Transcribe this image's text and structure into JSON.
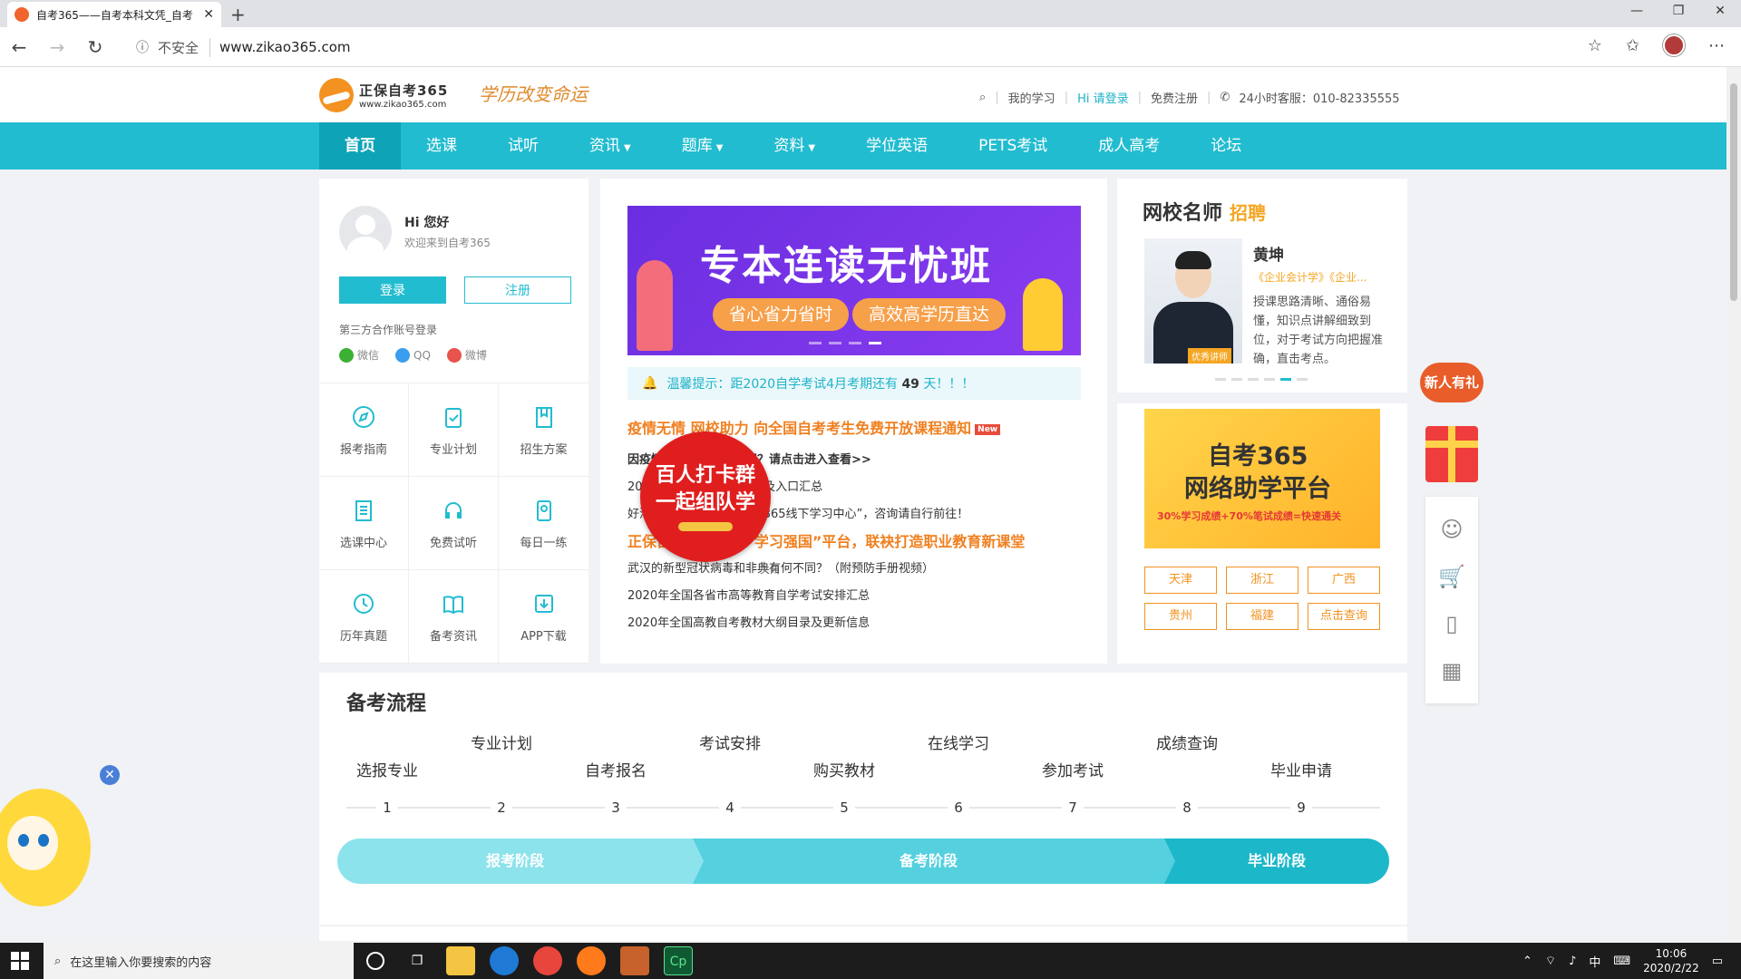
{
  "browser": {
    "tab_title": "自考365——自考本科文凭_自考",
    "tab_close": "✕",
    "new_tab": "+",
    "insecure_label": "不安全",
    "url": "www.zikao365.com",
    "window_min": "—",
    "window_max": "❐",
    "window_close": "✕"
  },
  "header": {
    "logo_name": "正保自考365",
    "logo_url": "www.zikao365.com",
    "slogan": "学历改变命运",
    "links": {
      "my_study": "我的学习",
      "login": "Hi 请登录",
      "register": "免费注册",
      "hotline": "24小时客服：010-82335555"
    }
  },
  "nav": {
    "items": [
      {
        "label": "首页",
        "active": true,
        "dropdown": false
      },
      {
        "label": "选课",
        "active": false,
        "dropdown": false
      },
      {
        "label": "试听",
        "active": false,
        "dropdown": false
      },
      {
        "label": "资讯",
        "active": false,
        "dropdown": true
      },
      {
        "label": "题库",
        "active": false,
        "dropdown": true
      },
      {
        "label": "资料",
        "active": false,
        "dropdown": true
      },
      {
        "label": "学位英语",
        "active": false,
        "dropdown": false
      },
      {
        "label": "PETS考试",
        "active": false,
        "dropdown": false
      },
      {
        "label": "成人高考",
        "active": false,
        "dropdown": false
      },
      {
        "label": "论坛",
        "active": false,
        "dropdown": false
      }
    ]
  },
  "user": {
    "greeting": "Hi 您好",
    "welcome": "欢迎来到自考365",
    "login_btn": "登录",
    "register_btn": "注册",
    "third_party_title": "第三方合作账号登录",
    "third_party": [
      {
        "label": "微信",
        "color": "#3cb034"
      },
      {
        "label": "QQ",
        "color": "#3a9ded"
      },
      {
        "label": "微博",
        "color": "#e8534c"
      }
    ]
  },
  "quick_links": [
    {
      "label": "报考指南",
      "icon": "compass-icon"
    },
    {
      "label": "专业计划",
      "icon": "clipboard-icon"
    },
    {
      "label": "招生方案",
      "icon": "book-icon"
    },
    {
      "label": "选课中心",
      "icon": "list-icon"
    },
    {
      "label": "免费试听",
      "icon": "headphones-icon"
    },
    {
      "label": "每日一练",
      "icon": "location-icon"
    },
    {
      "label": "历年真题",
      "icon": "history-icon"
    },
    {
      "label": "备考资讯",
      "icon": "open-book-icon"
    },
    {
      "label": "APP下载",
      "icon": "download-icon"
    }
  ],
  "banner": {
    "title": "专本连读无忧班",
    "pill_1": "省心省力省时",
    "pill_2": "高效高学历直达"
  },
  "notice": {
    "prefix": "温馨提示：",
    "text": "距2020自学考试4月考期还有",
    "days": "49",
    "suffix": "天！！！"
  },
  "news": {
    "headline": "疫情无情 网校助力 向全国自考考生免费开放课程通知",
    "headline_badge": "New",
    "items": [
      {
        "text": "因疫情各省自考报名时间？请点击进入查看>>",
        "style": "b"
      },
      {
        "text": "2020年各省自考报名时间及入口汇总",
        "style": ""
      },
      {
        "text": "好消息：已开放“正保自考365线下学习中心”，咨询请自行前往！",
        "style": ""
      },
      {
        "text": "正保自考365携手“学习强国”平台，联袂打造职业教育新课堂",
        "style": "or"
      },
      {
        "text": "武汉的新型冠状病毒和非典有何不同？（附预防手册视频）",
        "style": ""
      },
      {
        "text": "2020年全国各省市高等教育自学考试安排汇总",
        "style": ""
      },
      {
        "text": "2020年全国高教自考教材大纲目录及更新信息",
        "style": ""
      }
    ]
  },
  "promo": {
    "line1": "百人打卡群",
    "line2": "一起组队学",
    "close": "关闭"
  },
  "teacher": {
    "section_title": "网校名师",
    "recruit": "招聘",
    "name": "黄坤",
    "courses": "《企业会计学》《企业...",
    "tag": "优秀讲师",
    "desc": "授课思路清晰、通俗易懂，知识点讲解细致到位，对于考试方向把握准确，直击考点。"
  },
  "platform": {
    "line1": "自考365",
    "line2": "网络助学平台",
    "line3": "30%学习成绩+70%笔试成绩=快速通关"
  },
  "regions": [
    "天津",
    "浙江",
    "广西",
    "贵州",
    "福建",
    "点击查询"
  ],
  "process": {
    "title": "备考流程",
    "steps": [
      {
        "num": "1",
        "label": "选报专业",
        "row": "low"
      },
      {
        "num": "2",
        "label": "专业计划",
        "row": "high"
      },
      {
        "num": "3",
        "label": "自考报名",
        "row": "low"
      },
      {
        "num": "4",
        "label": "考试安排",
        "row": "high"
      },
      {
        "num": "5",
        "label": "购买教材",
        "row": "low"
      },
      {
        "num": "6",
        "label": "在线学习",
        "row": "high"
      },
      {
        "num": "7",
        "label": "参加考试",
        "row": "low"
      },
      {
        "num": "8",
        "label": "成绩查询",
        "row": "high"
      },
      {
        "num": "9",
        "label": "毕业申请",
        "row": "low"
      }
    ],
    "stages": [
      "报考阶段",
      "备考阶段",
      "毕业阶段"
    ]
  },
  "float_bar": {
    "new_user": "新人有礼"
  },
  "taskbar": {
    "search_placeholder": "在这里输入你要搜索的内容",
    "ime": "中",
    "time": "10:06",
    "date": "2020/2/22"
  }
}
